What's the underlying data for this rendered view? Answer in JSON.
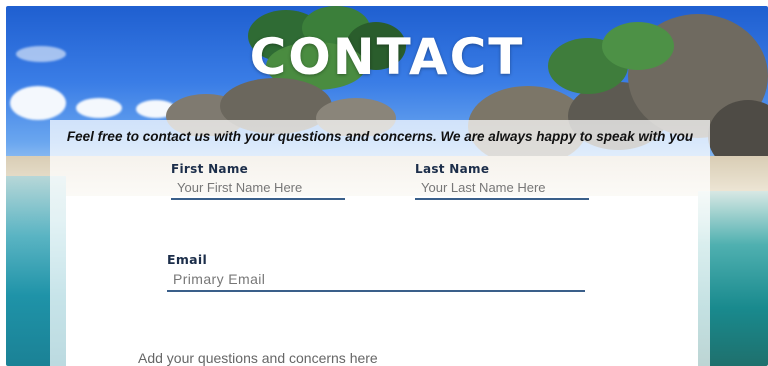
{
  "header": {
    "title": "CONTACT"
  },
  "panel": {
    "intro": "Feel free to contact us with your questions and concerns. We are always happy to speak with you"
  },
  "form": {
    "first_name": {
      "label": "First Name",
      "placeholder": "Your First Name Here",
      "value": ""
    },
    "last_name": {
      "label": "Last Name",
      "placeholder": "Your Last Name Here",
      "value": ""
    },
    "email": {
      "label": "Email",
      "placeholder": "Primary Email",
      "value": ""
    },
    "message": {
      "placeholder": "Add your questions and concerns here",
      "value": ""
    }
  },
  "colors": {
    "label_text": "#1c2e4a",
    "input_underline": "#3a5f8a",
    "title_text": "#ffffff",
    "panel_bg": "rgba(255,255,255,0.75)"
  }
}
